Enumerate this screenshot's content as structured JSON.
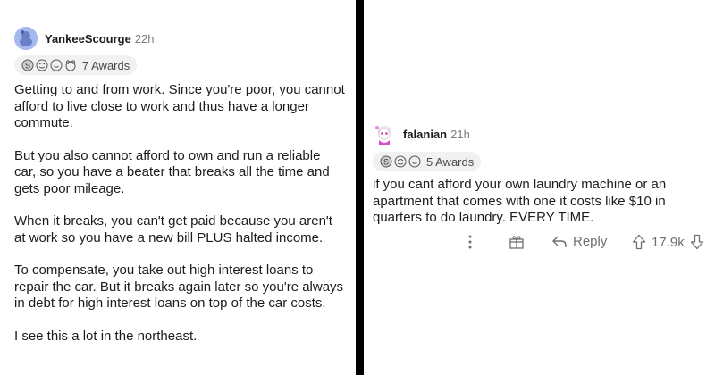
{
  "left_comment": {
    "username": "YankeeScourge",
    "time": "22h",
    "awards_label": "7 Awards",
    "paragraphs": [
      "Getting to and from work. Since you're poor, you cannot afford to live close to work and thus have a longer commute.",
      "But you also cannot afford to own and run a reliable car, so you have a beater that breaks all the time and gets poor mileage.",
      "When it breaks, you can't get paid because you aren't at work so you have a new bill PLUS halted income.",
      "To compensate, you take out high interest loans to repair the car. But it breaks again later so you're always in debt for high interest loans on top of the car costs.",
      "I see this a lot in the northeast."
    ]
  },
  "right_comment": {
    "username": "falanian",
    "time": "21h",
    "awards_label": "5 Awards",
    "body": "if you cant afford your own laundry machine or an apartment that comes with one it costs like $10 in quarters to do laundry. EVERY TIME.",
    "reply_label": "Reply",
    "vote_count": "17.9k"
  },
  "colors": {
    "left_avatar_bg": "#a5b8f0",
    "right_avatar_accent": "#d64bc6",
    "meta_gray": "#7c7c7c",
    "action_gray": "#707070"
  },
  "icons": [
    "award-silver-icon",
    "award-wholesome-icon",
    "award-helpful-icon",
    "award-hugz-icon",
    "more-options-icon",
    "give-award-icon",
    "reply-arrow-icon",
    "upvote-arrow-icon",
    "downvote-arrow-icon"
  ]
}
